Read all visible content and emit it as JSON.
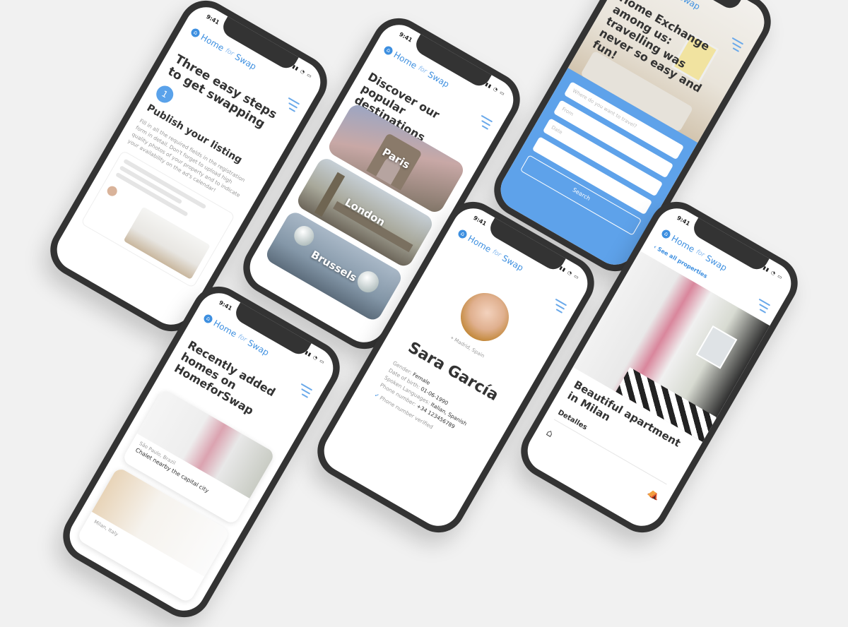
{
  "common": {
    "time": "9:41",
    "brand_home": "Home",
    "brand_for": "for",
    "brand_swap": "Swap",
    "status_icons": "▮▮ ◔ ▭"
  },
  "phone1": {
    "title": "Three easy steps to get swapping",
    "step_number": "1",
    "step_title": "Publish your listing",
    "step_text": "Fill in all the required fields in the registration form in detail. Don't forget to upload high quality photos of your property and to indicate your availability on the ad's calendar!"
  },
  "phone2": {
    "title": "Discover our popular destinations",
    "destinations": [
      "Paris",
      "London",
      "Brussels"
    ]
  },
  "phone3": {
    "title": "Home Exchange among us: travelling was never so easy and fun!",
    "where_placeholder": "Where do you want to travel?",
    "from_placeholder": "From",
    "date_placeholder": "Date",
    "search_label": "Search"
  },
  "phone4": {
    "title": "Recently added homes on HomeforSwap",
    "listing1_location": "São Paulo, Brazil",
    "listing1_desc": "Chalet nearby the capital city",
    "listing2_location": "Milan, Italy"
  },
  "phone5": {
    "location": "Madrid, Spain",
    "name": "Sara García",
    "gender_label": "Gender:",
    "gender_value": "Female",
    "dob_label": "Date of birth:",
    "dob_value": "01-06-1990",
    "languages_label": "Spoken Languages:",
    "languages_value": "Italian, Spanish",
    "phone_label": "Phone number:",
    "phone_value": "+34 123456789",
    "verified": "Phone number verified"
  },
  "phone6": {
    "back_link": "See all properties",
    "title": "Beautiful apartment in Milan",
    "details_label": "Detalles"
  },
  "colors": {
    "accent": "#3d8fe0",
    "background": "#f1f1f1",
    "frame": "#333333"
  }
}
